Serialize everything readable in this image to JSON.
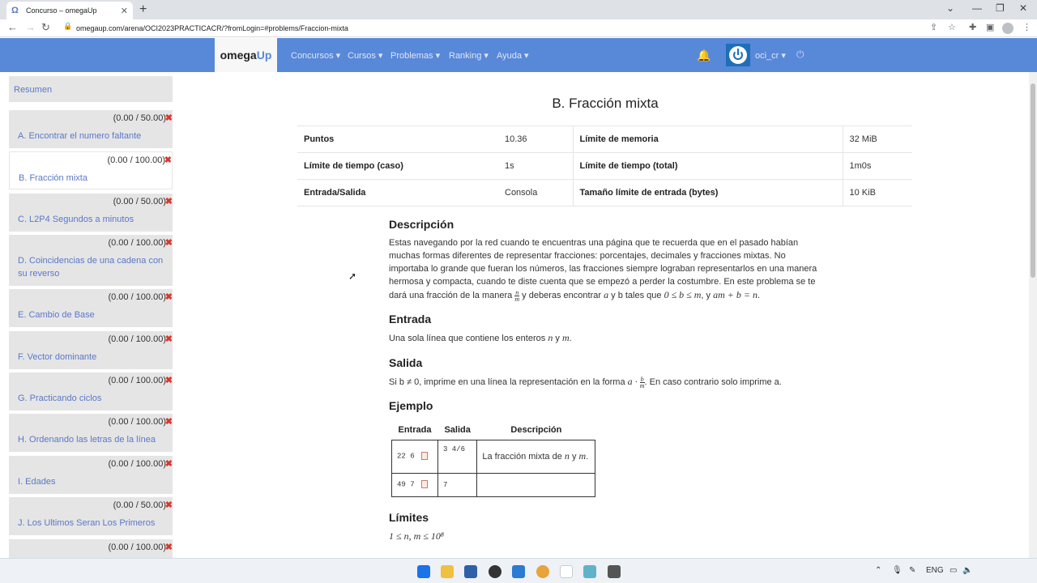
{
  "browser": {
    "tab_title": "Concurso – omegaUp",
    "url": "omegaup.com/arena/OCI2023PRACTICACR/?fromLogin=#problems/Fraccion-mixta",
    "new_tab": "+",
    "close": "✕"
  },
  "site": {
    "logo_main": "omega",
    "logo_accent": "Up",
    "nav": [
      "Concursos ▾",
      "Cursos ▾",
      "Problemas ▾",
      "Ranking ▾",
      "Ayuda ▾"
    ],
    "user": "oci_cr ▾"
  },
  "sidebar": {
    "summary": "Resumen",
    "items": [
      {
        "score": "(0.00 / 50.00)",
        "title": "A. Encontrar el numero faltante"
      },
      {
        "score": "(0.00 / 100.00)",
        "title": "B. Fracción mixta"
      },
      {
        "score": "(0.00 / 50.00)",
        "title": "C. L2P4 Segundos a minutos"
      },
      {
        "score": "(0.00 / 100.00)",
        "title": "D. Coincidencias de una cadena con su reverso"
      },
      {
        "score": "(0.00 / 100.00)",
        "title": "E. Cambio de Base"
      },
      {
        "score": "(0.00 / 100.00)",
        "title": "F. Vector dominante"
      },
      {
        "score": "(0.00 / 100.00)",
        "title": "G. Practicando ciclos"
      },
      {
        "score": "(0.00 / 100.00)",
        "title": "H. Ordenando las letras de la línea"
      },
      {
        "score": "(0.00 / 100.00)",
        "title": "I. Edades"
      },
      {
        "score": "(0.00 / 50.00)",
        "title": "J. Los Ultimos Seran Los Primeros"
      },
      {
        "score": "(0.00 / 100.00)",
        "title": ""
      }
    ],
    "x_mark": "✖"
  },
  "problem": {
    "title": "B. Fracción mixta",
    "info": [
      [
        "Puntos",
        "10.36",
        "Límite de memoria",
        "32 MiB"
      ],
      [
        "Límite de tiempo (caso)",
        "1s",
        "Límite de tiempo (total)",
        "1m0s"
      ],
      [
        "Entrada/Salida",
        "Consola",
        "Tamaño límite de entrada (bytes)",
        "10 KiB"
      ]
    ],
    "desc_heading": "Descripción",
    "desc_text": "Estas navegando por la red cuando te encuentras una página que te recuerda que en el pasado habían muchas formas diferentes de representar fracciones: porcentajes, decimales y fracciones mixtas. No importaba lo grande que fueran los números, las fracciones siempre lograban representarlos en una manera hermosa y compacta, cuando te diste cuenta que se empezó a perder la costumbre. En este problema se te dará una fracción de la manera",
    "desc_tail_1": "y deberas encontrar",
    "desc_tail_2": "y b tales que",
    "desc_tail_3": ", y",
    "math_a": "a",
    "math_ineq": "0 ≤ b ≤ m",
    "math_eq": "am + b = n",
    "frac_n": "n",
    "frac_m": "m",
    "input_heading": "Entrada",
    "input_text": "Una sola línea que contiene los enteros",
    "input_n": "n",
    "input_y": "y",
    "input_m": "m",
    "output_heading": "Salida",
    "output_text_1": "Si b ≠ 0, imprime en una línea la representación en la forma",
    "output_a": "a ·",
    "output_text_2": ". En caso contrario solo imprime a.",
    "frac_b": "b",
    "example_heading": "Ejemplo",
    "example_headers": [
      "Entrada",
      "Salida",
      "Descripción"
    ],
    "example_rows": [
      {
        "in": "22 6",
        "out": "3 4/6",
        "desc": "La fracción mixta de"
      },
      {
        "in": "49 7",
        "out": "7",
        "desc": ""
      }
    ],
    "limits_heading": "Límites",
    "limits_text": "1 ≤ n, m ≤ 10⁸"
  },
  "taskbar": {
    "lang": "ENG"
  },
  "icons": {
    "accent": "#5888d8",
    "error": "#d9362e"
  }
}
